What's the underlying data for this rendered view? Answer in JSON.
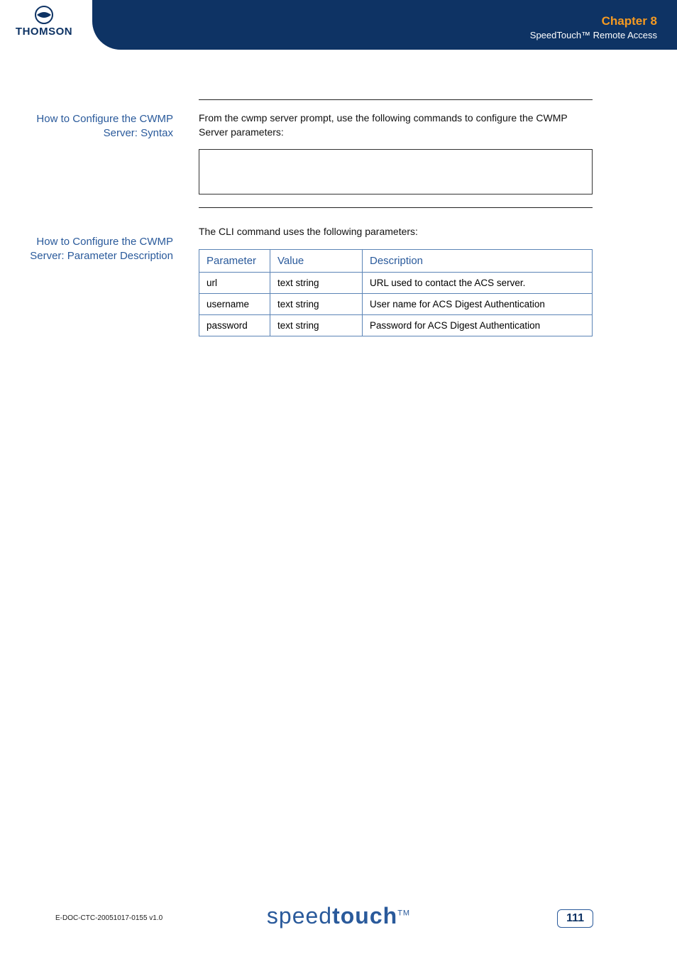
{
  "header": {
    "logo_text": "THOMSON",
    "chapter_title": "Chapter 8",
    "chapter_sub": "SpeedTouch™ Remote Access"
  },
  "section1": {
    "side_label": "How to Configure the CWMP Server: Syntax",
    "body": "From the cwmp server prompt, use the following commands to configure the CWMP Server parameters:"
  },
  "section2": {
    "side_label": "How to Configure the CWMP Server: Parameter Description",
    "body": "The CLI command uses the following parameters:",
    "table": {
      "headers": [
        "Parameter",
        "Value",
        "Description"
      ],
      "rows": [
        {
          "param": "url",
          "value": "text string",
          "desc": "URL used to contact the ACS server."
        },
        {
          "param": "username",
          "value": "text string",
          "desc": "User name for ACS Digest Authentication"
        },
        {
          "param": "password",
          "value": "text string",
          "desc": "Password for ACS Digest Authentication"
        }
      ]
    }
  },
  "footer": {
    "doc_id": "E-DOC-CTC-20051017-0155 v1.0",
    "brand_light": "speed",
    "brand_bold": "touch",
    "brand_tm": "TM",
    "page": "111"
  }
}
